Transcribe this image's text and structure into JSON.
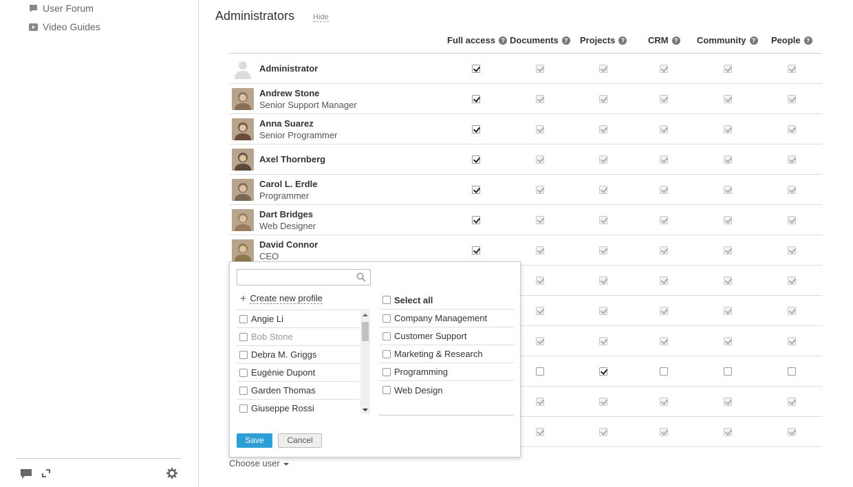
{
  "sidebar": {
    "links": [
      {
        "label": "User Forum",
        "icon": "speech-bubble-icon"
      },
      {
        "label": "Video Guides",
        "icon": "play-video-icon"
      }
    ],
    "bottom_icons": [
      "chat-icon",
      "expand-icon",
      "gear-icon"
    ]
  },
  "section": {
    "title": "Administrators",
    "hide_label": "Hide"
  },
  "columns": [
    {
      "label": "Full access",
      "help": "?"
    },
    {
      "label": "Documents",
      "help": "?"
    },
    {
      "label": "Projects",
      "help": "?"
    },
    {
      "label": "CRM",
      "help": "?"
    },
    {
      "label": "Community",
      "help": "?"
    },
    {
      "label": "People",
      "help": "?"
    }
  ],
  "rows": [
    {
      "name": "Administrator",
      "title": "",
      "avatar_color": "#dcdcdc",
      "checks": [
        true,
        true,
        true,
        true,
        true,
        true
      ],
      "disabled": [
        false,
        true,
        true,
        true,
        true,
        true
      ]
    },
    {
      "name": "Andrew Stone",
      "title": "Senior Support Manager",
      "avatar_color": "#8a6d55",
      "checks": [
        true,
        true,
        true,
        true,
        true,
        true
      ],
      "disabled": [
        false,
        true,
        true,
        true,
        true,
        true
      ]
    },
    {
      "name": "Anna Suarez",
      "title": "Senior Programmer",
      "avatar_color": "#6b4c3a",
      "checks": [
        true,
        true,
        true,
        true,
        true,
        true
      ],
      "disabled": [
        false,
        true,
        true,
        true,
        true,
        true
      ]
    },
    {
      "name": "Axel Thornberg",
      "title": "",
      "avatar_color": "#5a4a3c",
      "checks": [
        true,
        true,
        true,
        true,
        true,
        true
      ],
      "disabled": [
        false,
        true,
        true,
        true,
        true,
        true
      ]
    },
    {
      "name": "Carol L. Erdle",
      "title": "Programmer",
      "avatar_color": "#7a6a55",
      "checks": [
        true,
        true,
        true,
        true,
        true,
        true
      ],
      "disabled": [
        false,
        true,
        true,
        true,
        true,
        true
      ]
    },
    {
      "name": "Dart Bridges",
      "title": "Web Designer",
      "avatar_color": "#9a7a5c",
      "checks": [
        true,
        true,
        true,
        true,
        true,
        true
      ],
      "disabled": [
        false,
        true,
        true,
        true,
        true,
        true
      ]
    },
    {
      "name": "David Connor",
      "title": "CEO",
      "avatar_color": "#8c7a4a",
      "checks": [
        true,
        true,
        true,
        true,
        true,
        true
      ],
      "disabled": [
        false,
        true,
        true,
        true,
        true,
        true
      ]
    },
    {
      "name": "",
      "title": "",
      "avatar_color": "",
      "checks": [
        true,
        true,
        true,
        true,
        true,
        true
      ],
      "disabled": [
        false,
        true,
        true,
        true,
        true,
        true
      ]
    },
    {
      "name": "",
      "title": "",
      "avatar_color": "",
      "checks": [
        true,
        true,
        true,
        true,
        true,
        true
      ],
      "disabled": [
        false,
        true,
        true,
        true,
        true,
        true
      ]
    },
    {
      "name": "",
      "title": "",
      "avatar_color": "",
      "checks": [
        true,
        true,
        true,
        true,
        true,
        true
      ],
      "disabled": [
        false,
        true,
        true,
        true,
        true,
        true
      ]
    },
    {
      "name": "",
      "title": "",
      "avatar_color": "",
      "checks": [
        false,
        false,
        true,
        false,
        false,
        false
      ],
      "disabled": [
        false,
        false,
        false,
        false,
        false,
        false
      ]
    },
    {
      "name": "",
      "title": "",
      "avatar_color": "",
      "checks": [
        true,
        true,
        true,
        true,
        true,
        true
      ],
      "disabled": [
        false,
        true,
        true,
        true,
        true,
        true
      ]
    },
    {
      "name": "",
      "title": "",
      "avatar_color": "",
      "checks": [
        true,
        true,
        true,
        true,
        true,
        true
      ],
      "disabled": [
        false,
        true,
        true,
        true,
        true,
        true
      ]
    }
  ],
  "choose_user": {
    "label": "Choose user"
  },
  "popup": {
    "search_placeholder": "",
    "create_new_label": "Create new profile",
    "users": [
      {
        "label": "Angie Li",
        "gray": false
      },
      {
        "label": "Bob Stone",
        "gray": true
      },
      {
        "label": "Debra M. Griggs",
        "gray": false
      },
      {
        "label": "Eugénie Dupont",
        "gray": false
      },
      {
        "label": "Garden Thomas",
        "gray": false
      },
      {
        "label": "Giuseppe Rossi",
        "gray": false
      }
    ],
    "select_all_label": "Select all",
    "groups": [
      "Company Management",
      "Customer Support",
      "Marketing & Research",
      "Programming",
      "Web Design"
    ],
    "save_label": "Save",
    "cancel_label": "Cancel"
  }
}
